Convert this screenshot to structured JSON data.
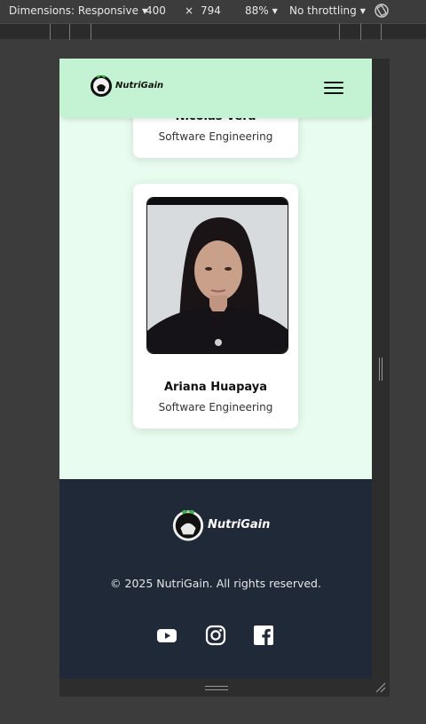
{
  "devtools": {
    "dimensions_label": "Dimensions: Responsive",
    "width": "400",
    "times": "×",
    "height": "794",
    "zoom": "88%",
    "throttling": "No throttling"
  },
  "header": {
    "brand": "NutriGain"
  },
  "team": [
    {
      "name": "Nicolás Vera",
      "role": "Software Engineering"
    },
    {
      "name": "Ariana Huapaya",
      "role": "Software Engineering"
    }
  ],
  "footer": {
    "brand": "NutriGain",
    "copyright": "© 2025 NutriGain. All rights reserved.",
    "social": [
      "youtube-icon",
      "instagram-icon",
      "facebook-icon"
    ]
  },
  "colors": {
    "header_bg": "#c3f3d3",
    "page_bg": "#e8fcef",
    "footer_bg": "#202938"
  }
}
